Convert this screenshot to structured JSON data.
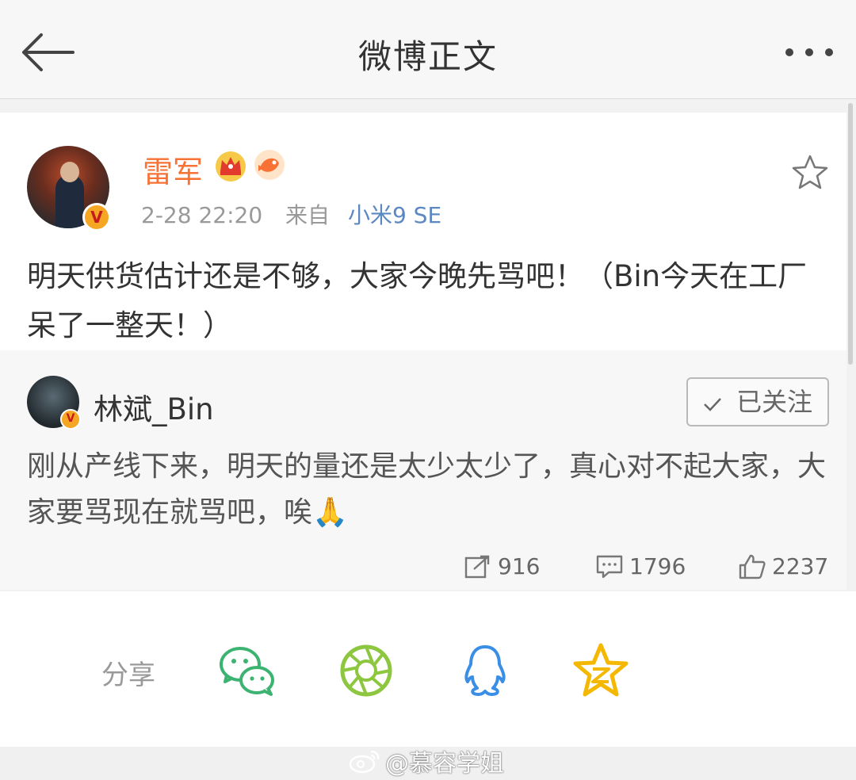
{
  "nav": {
    "title": "微博正文",
    "back_icon": "arrow-left-icon",
    "more_icon": "more-dots-icon"
  },
  "post": {
    "username": "雷军",
    "timestamp": "2-28 22:20",
    "source_prefix": "来自",
    "source": "小米9 SE",
    "text": "明天供货估计还是不够，大家今晚先骂吧！（Bin今天在工厂呆了一整天！）",
    "verified_badge": "V",
    "colors": {
      "username": "#f77234",
      "source": "#5c88c1"
    }
  },
  "repost": {
    "username": "林斌_Bin",
    "follow_label": "已关注",
    "follow_icon": "check-icon",
    "text": "刚从产线下来，明天的量还是太少太少了，真心对不起大家，大家要骂现在就骂吧，唉🙏",
    "verified_badge": "V",
    "stats": {
      "reposts": "916",
      "comments": "1796",
      "likes": "2237"
    }
  },
  "share": {
    "label": "分享",
    "targets": [
      "wechat-icon",
      "moments-icon",
      "qq-icon",
      "qzone-icon"
    ]
  },
  "watermark": "@慕容学姐"
}
